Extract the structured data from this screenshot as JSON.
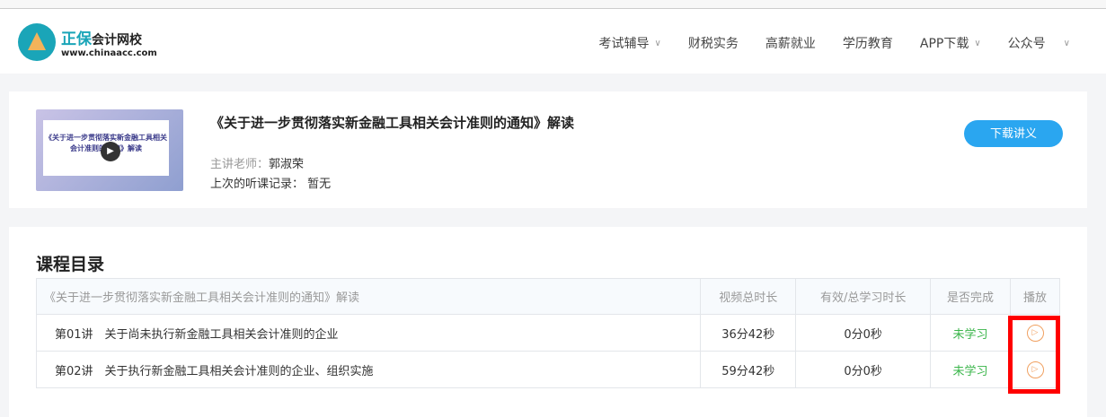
{
  "header": {
    "logo_main": "正保",
    "logo_sub": "会计网校",
    "logo_url": "www.chinaacc.com",
    "nav": [
      {
        "label": "考试辅导",
        "dropdown": true
      },
      {
        "label": "财税实务",
        "dropdown": false
      },
      {
        "label": "高薪就业",
        "dropdown": false
      },
      {
        "label": "学历教育",
        "dropdown": false
      },
      {
        "label": "APP下载",
        "dropdown": true
      },
      {
        "label": "公众号",
        "dropdown": true
      }
    ]
  },
  "course": {
    "thumb_text": "《关于进一步贯彻落实新金融工具相关会计准则的通知》解读",
    "title": "《关于进一步贯彻落实新金融工具相关会计准则的通知》解读",
    "teacher_label": "主讲老师：",
    "teacher": "郭淑荣",
    "record_label": "上次的听课记录：",
    "record": "暂无",
    "download_label": "下载讲义"
  },
  "catalog": {
    "title": "课程目录",
    "headers": [
      "《关于进一步贯彻落实新金融工具相关会计准则的通知》解读",
      "视频总时长",
      "有效/总学习时长",
      "是否完成",
      "播放"
    ],
    "rows": [
      {
        "name": "第01讲　关于尚未执行新金融工具相关会计准则的企业",
        "duration": "36分42秒",
        "studied": "0分0秒",
        "status": "未学习"
      },
      {
        "name": "第02讲　关于执行新金融工具相关会计准则的企业、组织实施",
        "duration": "59分42秒",
        "studied": "0分0秒",
        "status": "未学习"
      }
    ]
  },
  "colors": {
    "accent": "#2aa6f0",
    "status": "#3ab54a",
    "play": "#f0a060",
    "highlight": "#ff0000"
  }
}
